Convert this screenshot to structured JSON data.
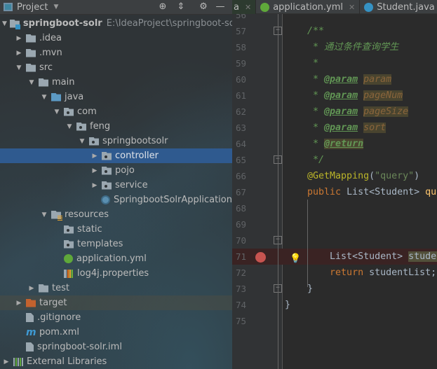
{
  "project_panel": {
    "title": "Project",
    "tree": [
      {
        "label": "springboot-solr",
        "path": "E:\\IdeaProject\\springboot-solr",
        "level": 0,
        "arrow": "open",
        "icon": "module",
        "bold": true
      },
      {
        "label": ".idea",
        "level": 1,
        "arrow": "closed",
        "icon": "folder"
      },
      {
        "label": ".mvn",
        "level": 1,
        "arrow": "closed",
        "icon": "folder"
      },
      {
        "label": "src",
        "level": 1,
        "arrow": "open",
        "icon": "folder"
      },
      {
        "label": "main",
        "level": 2,
        "arrow": "open",
        "icon": "folder"
      },
      {
        "label": "java",
        "level": 3,
        "arrow": "open",
        "icon": "source-folder"
      },
      {
        "label": "com",
        "level": 4,
        "arrow": "open",
        "icon": "package"
      },
      {
        "label": "feng",
        "level": 5,
        "arrow": "open",
        "icon": "package"
      },
      {
        "label": "springbootsolr",
        "level": 6,
        "arrow": "open",
        "icon": "package"
      },
      {
        "label": "controller",
        "level": 7,
        "arrow": "closed",
        "icon": "package",
        "selected": true
      },
      {
        "label": "pojo",
        "level": 7,
        "arrow": "closed",
        "icon": "package"
      },
      {
        "label": "service",
        "level": 7,
        "arrow": "closed",
        "icon": "package"
      },
      {
        "label": "SpringbootSolrApplication",
        "level": 7,
        "arrow": "none",
        "icon": "spring-app"
      },
      {
        "label": "resources",
        "level": 3,
        "arrow": "open",
        "icon": "resources"
      },
      {
        "label": "static",
        "level": 4,
        "arrow": "none",
        "icon": "package"
      },
      {
        "label": "templates",
        "level": 4,
        "arrow": "none",
        "icon": "package"
      },
      {
        "label": "application.yml",
        "level": 4,
        "arrow": "none",
        "icon": "spring"
      },
      {
        "label": "log4j.properties",
        "level": 4,
        "arrow": "none",
        "icon": "properties"
      },
      {
        "label": "test",
        "level": 2,
        "arrow": "closed",
        "icon": "folder"
      },
      {
        "label": "target",
        "level": 1,
        "arrow": "closed",
        "icon": "excluded-folder",
        "highlight": true
      },
      {
        "label": ".gitignore",
        "level": 1,
        "arrow": "none",
        "icon": "file"
      },
      {
        "label": "pom.xml",
        "level": 1,
        "arrow": "none",
        "icon": "maven"
      },
      {
        "label": "springboot-solr.iml",
        "level": 1,
        "arrow": "none",
        "icon": "file"
      },
      {
        "label": "External Libraries",
        "level": 0,
        "arrow": "closed",
        "icon": "libraries"
      }
    ]
  },
  "tabs": [
    {
      "label": "a",
      "icon": "none"
    },
    {
      "label": "application.yml",
      "icon": "spring"
    },
    {
      "label": "Student.java",
      "icon": "class"
    }
  ],
  "editor": {
    "lines": [
      {
        "n": "56",
        "segs": []
      },
      {
        "n": "57",
        "fold": true,
        "segs": [
          {
            "t": "    /**",
            "c": "doc"
          }
        ]
      },
      {
        "n": "58",
        "segs": [
          {
            "t": "     * 通过条件查询学生",
            "c": "doc"
          }
        ]
      },
      {
        "n": "59",
        "segs": [
          {
            "t": "     *",
            "c": "doc"
          }
        ]
      },
      {
        "n": "60",
        "segs": [
          {
            "t": "     * ",
            "c": "doc"
          },
          {
            "t": "@param",
            "c": "tag"
          },
          {
            "t": " ",
            "c": "doc"
          },
          {
            "t": "param",
            "c": "pn"
          }
        ]
      },
      {
        "n": "61",
        "segs": [
          {
            "t": "     * ",
            "c": "doc"
          },
          {
            "t": "@param",
            "c": "tag"
          },
          {
            "t": " ",
            "c": "doc"
          },
          {
            "t": "pageNum",
            "c": "pn"
          }
        ]
      },
      {
        "n": "62",
        "segs": [
          {
            "t": "     * ",
            "c": "doc"
          },
          {
            "t": "@param",
            "c": "tag"
          },
          {
            "t": " ",
            "c": "doc"
          },
          {
            "t": "pageSize",
            "c": "pn"
          }
        ]
      },
      {
        "n": "63",
        "segs": [
          {
            "t": "     * ",
            "c": "doc"
          },
          {
            "t": "@param",
            "c": "tag"
          },
          {
            "t": " ",
            "c": "doc"
          },
          {
            "t": "sort",
            "c": "pn"
          }
        ]
      },
      {
        "n": "64",
        "segs": [
          {
            "t": "     * ",
            "c": "doc"
          },
          {
            "t": "@return",
            "c": "tag tagbg"
          }
        ]
      },
      {
        "n": "65",
        "fold": true,
        "segs": [
          {
            "t": "     */",
            "c": "doc"
          }
        ]
      },
      {
        "n": "66",
        "segs": [
          {
            "t": "    @GetMapping",
            "c": "ann"
          },
          {
            "t": "(",
            "c": ""
          },
          {
            "t": "\"query\"",
            "c": "str"
          },
          {
            "t": ")",
            "c": ""
          }
        ]
      },
      {
        "n": "67",
        "segs": [
          {
            "t": "    public ",
            "c": "kw"
          },
          {
            "t": "List<Student> ",
            "c": ""
          },
          {
            "t": "queryStudent",
            "c": "fn"
          }
        ]
      },
      {
        "n": "68",
        "segs": []
      },
      {
        "n": "69",
        "segs": []
      },
      {
        "n": "70",
        "fold": true,
        "segs": []
      },
      {
        "n": "71",
        "breakpoint": true,
        "bulb": true,
        "segs": [
          {
            "t": "        List<Student> ",
            "c": ""
          },
          {
            "t": "studentList",
            "c": "hl"
          }
        ]
      },
      {
        "n": "72",
        "segs": [
          {
            "t": "        return ",
            "c": "kw"
          },
          {
            "t": "studentList;",
            "c": ""
          }
        ]
      },
      {
        "n": "73",
        "fold": true,
        "segs": [
          {
            "t": "    }",
            "c": ""
          }
        ]
      },
      {
        "n": "74",
        "segs": [
          {
            "t": "}",
            "c": ""
          }
        ]
      },
      {
        "n": "75",
        "segs": []
      }
    ]
  }
}
